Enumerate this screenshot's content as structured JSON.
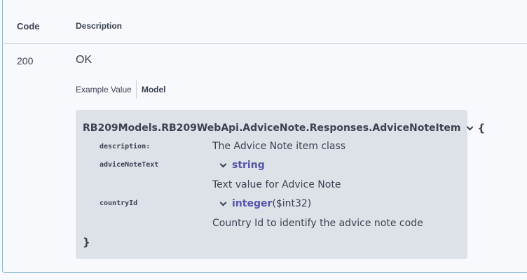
{
  "table": {
    "header_code": "Code",
    "header_description": "Description"
  },
  "response": {
    "code": "200",
    "description": "OK"
  },
  "tabs": {
    "example_value": "Example Value",
    "model": "Model",
    "active": "Model"
  },
  "model": {
    "name": "RB209Models.RB209WebApi.AdviceNote.Responses.AdviceNoteItem",
    "open_brace": "{",
    "close_brace": "}",
    "description_label": "description:",
    "description_text": "The Advice Note item class",
    "properties": [
      {
        "name": "adviceNoteText",
        "type": "string",
        "format": "",
        "description": "Text value for Advice Note"
      },
      {
        "name": "countryId",
        "type": "integer",
        "format": "($int32)",
        "description": "Country Id to identify the advice note code"
      }
    ]
  },
  "colors": {
    "text": "#3b4151",
    "type_name": "#5555aa",
    "model_background": "#dde2e8",
    "panel_border": "#8cb7d6"
  }
}
